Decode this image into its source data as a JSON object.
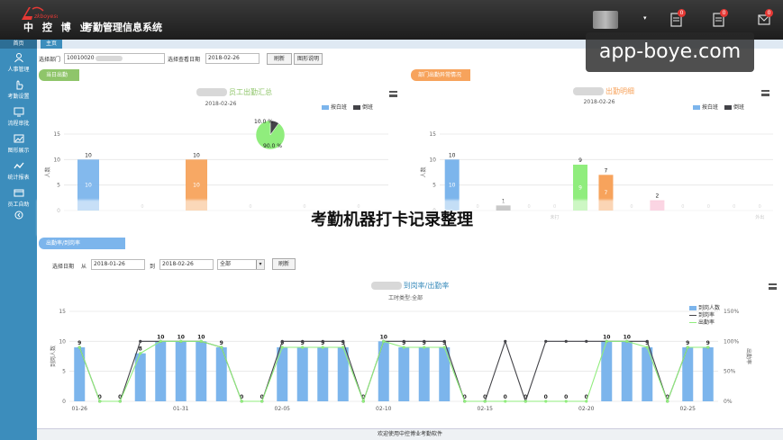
{
  "header": {
    "brand": "中 控 博 业",
    "system_title": "考勤管理信息系统",
    "notifications": [
      {
        "icon": "document-icon",
        "count": "0"
      },
      {
        "icon": "document-icon",
        "count": "0"
      },
      {
        "icon": "mail-icon",
        "count": "0"
      }
    ]
  },
  "watermark": "app-boye.com",
  "sidebar": {
    "head": "首页",
    "items": [
      {
        "label": "人事管理",
        "icon": "person-icon"
      },
      {
        "label": "考勤设置",
        "icon": "hand-icon"
      },
      {
        "label": "流程审批",
        "icon": "monitor-icon"
      },
      {
        "label": "图形展示",
        "icon": "image-icon"
      },
      {
        "label": "统计报表",
        "icon": "linechart-icon"
      },
      {
        "label": "员工自助",
        "icon": "card-icon"
      }
    ]
  },
  "tabs": [
    {
      "label": "主页"
    }
  ],
  "filter_top": {
    "dept_label": "选择部门",
    "dept_value": "10010020",
    "date_label": "选择查看日期",
    "date_value": "2018-02-26",
    "refresh_label": "刷新",
    "legend_btn_label": "图形说明"
  },
  "panel_left": {
    "tag": "当日出勤",
    "title": "员工出勤汇总",
    "date": "2018-02-26",
    "legend": [
      {
        "name": "按白班",
        "color": "#7cb5ec"
      },
      {
        "name": "倒班",
        "color": "#434348"
      }
    ]
  },
  "panel_right": {
    "tag": "部门出勤异常情况",
    "title": "出勤明细",
    "date": "2018-02-26",
    "legend": [
      {
        "name": "按白班",
        "color": "#7cb5ec"
      },
      {
        "name": "倒班",
        "color": "#434348"
      }
    ]
  },
  "panel_bottom": {
    "tag": "出勤率/到岗率",
    "date_label": "选择日期",
    "from_label": "从",
    "from_value": "2018-01-26",
    "to_label": "到",
    "to_value": "2018-02-26",
    "scope_value": "全部",
    "refresh_label": "刷新",
    "title": "到岗率/出勤率",
    "subtitle": "工时类型:全部",
    "legend": [
      {
        "name": "到岗人数",
        "color": "#7cb5ec"
      },
      {
        "name": "到岗率",
        "color": "#434348"
      },
      {
        "name": "出勤率",
        "color": "#90ed7d"
      }
    ]
  },
  "overlay_caption": "考勤机器打卡记录整理",
  "footer": "欢迎使用中控博业考勤软件",
  "chart_data": [
    {
      "type": "bar",
      "title": "员工出勤汇总",
      "subtitle": "2018-02-26",
      "ylabel": "人数",
      "ylim": [
        0,
        15
      ],
      "yticks": [
        "0",
        "5",
        "10",
        "15"
      ],
      "categories": [
        "应出人数",
        "实到",
        "出勤人数",
        "外出",
        "迟到",
        "早退"
      ],
      "series": [
        {
          "name": "按白班",
          "values": [
            10,
            0,
            10,
            0,
            0,
            0
          ]
        },
        {
          "name": "倒班",
          "values": [
            0,
            0,
            0,
            0,
            0,
            0
          ]
        }
      ],
      "bar_labels": [
        "10",
        "10",
        "10",
        "10"
      ],
      "pie": {
        "slices": [
          {
            "label": "10.0 %",
            "value": 10.0
          },
          {
            "label": "90.0 %",
            "value": 90.0
          }
        ]
      }
    },
    {
      "type": "bar",
      "title": "出勤明细",
      "subtitle": "2018-02-26",
      "ylabel": "人数",
      "ylim": [
        0,
        15
      ],
      "yticks": [
        "0",
        "5",
        "10",
        "15"
      ],
      "categories": [
        "c1",
        "c2",
        "c3",
        "c4",
        "c5",
        "c6",
        "c7",
        "c8",
        "c9",
        "c10",
        "c11",
        "c12",
        "c13"
      ],
      "tick_labels": [
        "",
        "",
        "",
        "",
        "未打",
        "",
        "",
        "",
        "",
        "",
        "",
        "",
        "外出"
      ],
      "series": [
        {
          "name": "按白班",
          "values": [
            10,
            0,
            1,
            0,
            0,
            9,
            7,
            0,
            2,
            0,
            0,
            0,
            0
          ],
          "colors": [
            "#7cb5ec",
            "#7cb5ec",
            "#888888",
            "#7cb5ec",
            "#7cb5ec",
            "#90ed7d",
            "#f7a35c",
            "#7cb5ec",
            "#f7a3c0",
            "#7cb5ec",
            "#7cb5ec",
            "#7cb5ec",
            "#7cb5ec"
          ]
        },
        {
          "name": "倒班",
          "values": [
            0,
            0,
            0,
            0,
            0,
            0,
            0,
            0,
            0,
            0,
            0,
            0,
            0
          ]
        }
      ],
      "bar_labels": [
        "10",
        "10",
        "9",
        "9",
        "7",
        "7",
        "2"
      ]
    },
    {
      "type": "bar",
      "title": "到岗率/出勤率",
      "subtitle": "工时类型:全部",
      "ylabel": "到岗人数",
      "y2label": "出勤率",
      "ylim": [
        0,
        15
      ],
      "yticks": [
        "0",
        "5",
        "10",
        "15"
      ],
      "y2ticks": [
        "0%",
        "50%",
        "100%",
        "150%"
      ],
      "xticks": [
        "01-26",
        "01-31",
        "02-05",
        "02-10",
        "02-15",
        "02-20",
        "02-25"
      ],
      "categories": [
        "01-26",
        "01-27",
        "01-28",
        "01-29",
        "01-30",
        "01-31",
        "02-01",
        "02-02",
        "02-03",
        "02-04",
        "02-05",
        "02-06",
        "02-07",
        "02-08",
        "02-09",
        "02-10",
        "02-11",
        "02-12",
        "02-13",
        "02-14",
        "02-15",
        "02-16",
        "02-17",
        "02-18",
        "02-19",
        "02-20",
        "02-21",
        "02-22",
        "02-23",
        "02-24",
        "02-25",
        "02-26"
      ],
      "series": [
        {
          "name": "到岗人数",
          "values": [
            9,
            0,
            0,
            8,
            10,
            10,
            10,
            9,
            0,
            0,
            9,
            9,
            9,
            9,
            0,
            10,
            9,
            9,
            9,
            0,
            0,
            0,
            0,
            0,
            0,
            0,
            10,
            10,
            9,
            0,
            9,
            9
          ]
        },
        {
          "name": "到岗率",
          "values": [
            90,
            0,
            0,
            100,
            100,
            100,
            100,
            90,
            0,
            0,
            100,
            100,
            100,
            100,
            0,
            100,
            100,
            100,
            100,
            0,
            0,
            100,
            0,
            100,
            100,
            100,
            100,
            100,
            100,
            0,
            90,
            90
          ]
        },
        {
          "name": "出勤率",
          "values": [
            90,
            0,
            0,
            80,
            100,
            100,
            100,
            90,
            0,
            0,
            90,
            90,
            90,
            90,
            0,
            100,
            90,
            90,
            90,
            0,
            0,
            0,
            0,
            0,
            0,
            0,
            100,
            100,
            90,
            0,
            90,
            90
          ]
        }
      ]
    }
  ]
}
